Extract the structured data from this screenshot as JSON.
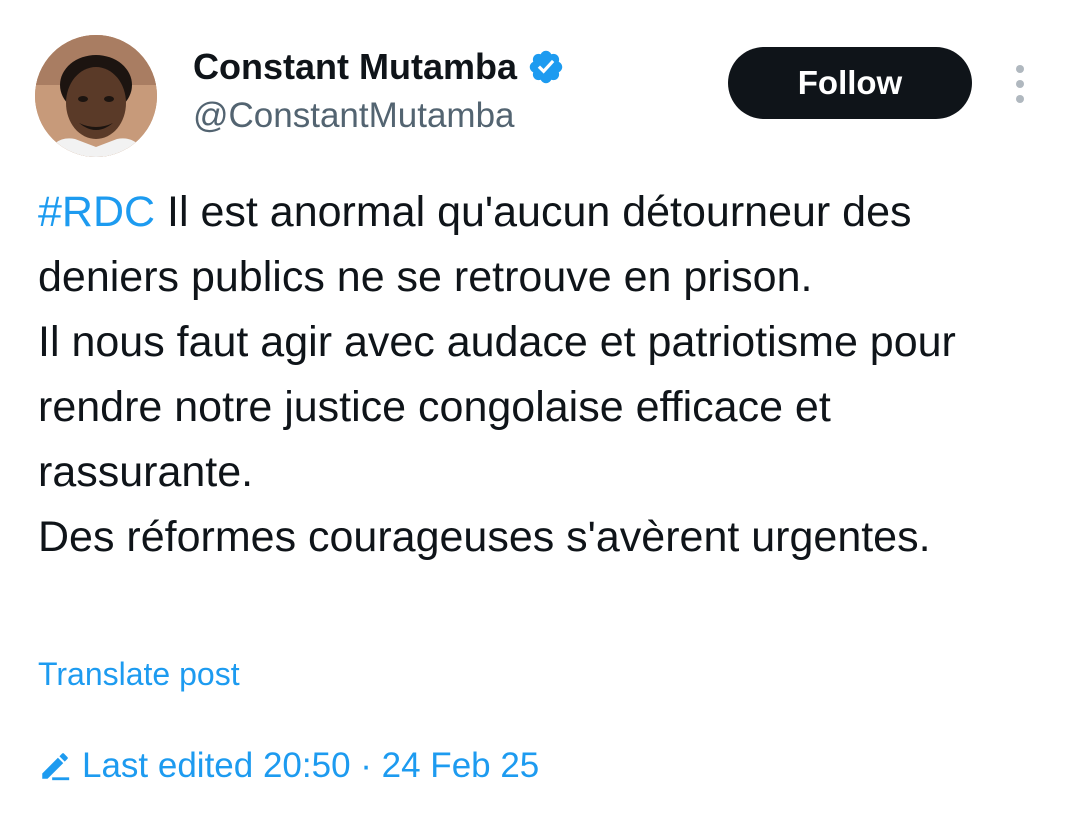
{
  "author": {
    "display_name": "Constant Mutamba",
    "handle": "@ConstantMutamba",
    "verified": true
  },
  "actions": {
    "follow_label": "Follow",
    "more_icon": "more-vertical-icon"
  },
  "tweet": {
    "hashtag": "#RDC",
    "line_1": "Il est anormal qu'aucun détourneur des deniers publics ne se retrouve en prison.",
    "line_2": "Il nous faut agir avec audace et patriotisme pour rendre notre justice congolaise efficace et rassurante.",
    "line_3": "Des réformes courageuses s'avèrent urgentes."
  },
  "translate_label": "Translate post",
  "edit_info": {
    "icon": "pencil-icon",
    "label": "Last edited 20:50 · 24 Feb 25"
  },
  "colors": {
    "accent": "#1d9bf0",
    "text": "#0f1419",
    "secondary": "#536471",
    "button_bg": "#0f1419"
  }
}
